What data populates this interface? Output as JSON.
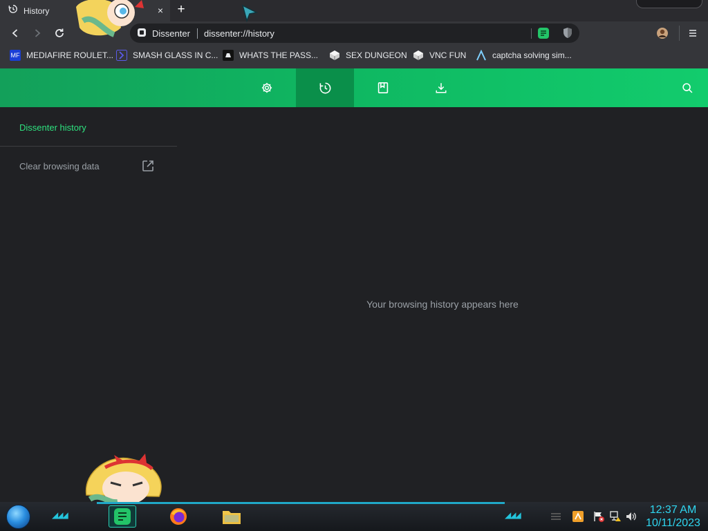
{
  "tab": {
    "title": "History",
    "close": "×",
    "new_tab": "+"
  },
  "toolbar": {
    "site_name": "Dissenter",
    "url": "dissenter://history"
  },
  "bookmarks": [
    {
      "label": "MEDIAFIRE ROULET...",
      "icon_text": "MF",
      "icon_color": "#1a3fd6"
    },
    {
      "label": "SMASH GLASS IN C...",
      "icon_text": "",
      "icon_color": "#4b4bd6"
    },
    {
      "label": "WHATS THE PASS...",
      "icon_text": "",
      "icon_color": "#111111"
    },
    {
      "label": "SEX DUNGEON",
      "icon_text": "",
      "icon_color": "#555555"
    },
    {
      "label": "VNC FUN",
      "icon_text": "",
      "icon_color": "#555555"
    },
    {
      "label": "captcha solving sim...",
      "icon_text": "",
      "icon_color": "#35363a"
    }
  ],
  "header_nav": [
    {
      "name": "settings",
      "icon": "gear-icon"
    },
    {
      "name": "history",
      "icon": "history-icon",
      "active": true
    },
    {
      "name": "bookmarks",
      "icon": "bookmark-icon"
    },
    {
      "name": "downloads",
      "icon": "download-icon"
    }
  ],
  "sidebar": {
    "title": "Dissenter history",
    "clear_label": "Clear browsing data"
  },
  "main": {
    "empty_message": "Your browsing history appears here"
  },
  "taskbar": {
    "time": "12:37 AM",
    "date": "10/11/2023"
  },
  "colors": {
    "accent": "#0fb862",
    "sidebar_title": "#2ee27f",
    "clock": "#2fd6f0"
  }
}
